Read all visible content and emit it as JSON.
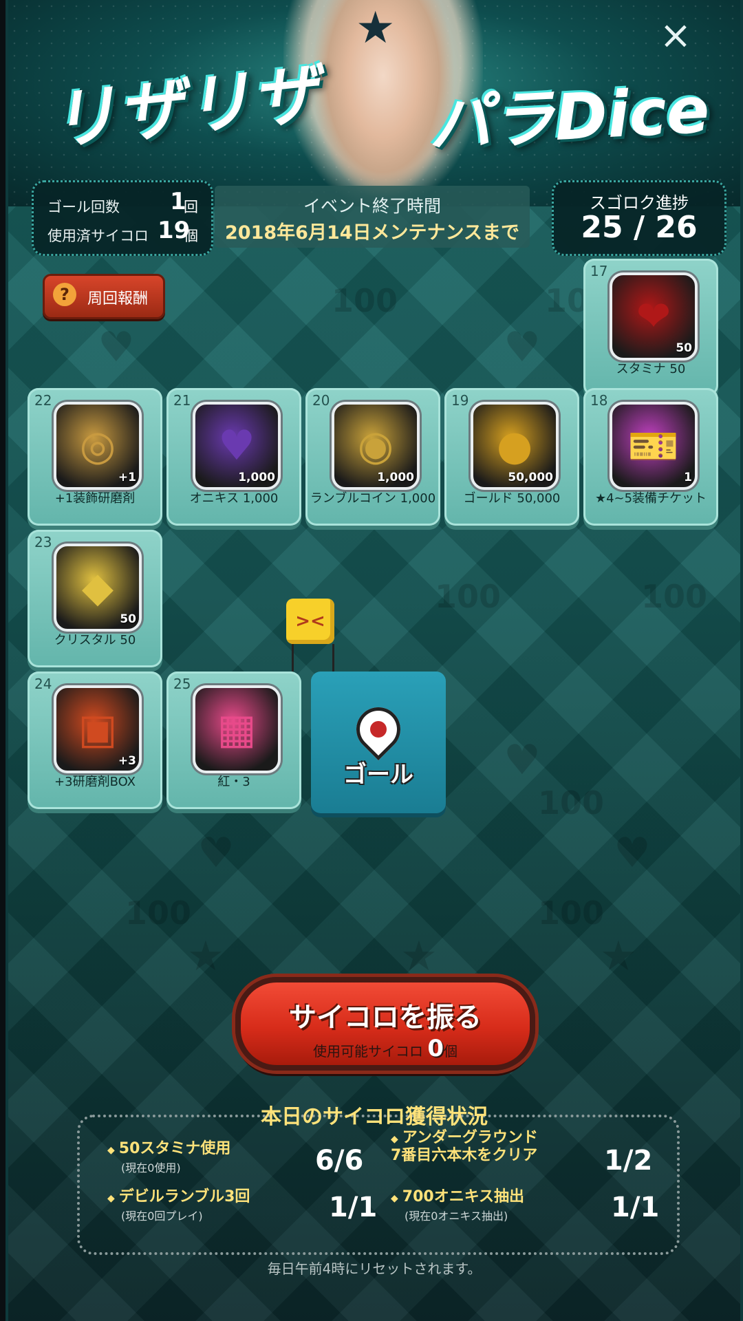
{
  "header": {
    "logo_left": "リザリザ",
    "logo_right": "パラDice",
    "close_icon": "×"
  },
  "stats": {
    "goal_count_label": "ゴール回数",
    "goal_count_value": "1",
    "goal_count_unit": "回",
    "used_dice_label": "使用済サイコロ",
    "used_dice_value": "19",
    "used_dice_unit": "個"
  },
  "event": {
    "title": "イベント終了時間",
    "date": "2018年6月14日メンテナンスまで"
  },
  "progress": {
    "label": "スゴロク進捗",
    "value": "25 / 26"
  },
  "reward_button": {
    "icon": "?",
    "label": "周回報酬"
  },
  "tiles": [
    {
      "num": "17",
      "label": "スタミナ 50",
      "badge": "50",
      "icon": "heart-icon",
      "glyph": "❤",
      "color": "#b01818"
    },
    {
      "num": "18",
      "label": "★4~5装備チケット",
      "badge": "1",
      "icon": "ticket-icon",
      "glyph": "🎫",
      "color": "#c040c0"
    },
    {
      "num": "19",
      "label": "ゴールド 50,000",
      "badge": "50,000",
      "icon": "gold-coins-icon",
      "glyph": "●",
      "color": "#d6a020"
    },
    {
      "num": "20",
      "label": "ランブルコイン 1,000",
      "badge": "1,000",
      "icon": "rumble-coin-icon",
      "glyph": "◉",
      "color": "#c9a23a"
    },
    {
      "num": "21",
      "label": "オニキス 1,000",
      "badge": "1,000",
      "icon": "onyx-icon",
      "glyph": "♥",
      "color": "#6a3ab0"
    },
    {
      "num": "22",
      "label": "+1装飾研磨剤",
      "badge": "+1",
      "icon": "polish-icon",
      "glyph": "◎",
      "color": "#c89a40"
    },
    {
      "num": "23",
      "label": "クリスタル 50",
      "badge": "50",
      "icon": "crystal-icon",
      "glyph": "◆",
      "color": "#e0c040"
    },
    {
      "num": "24",
      "label": "+3研磨剤BOX",
      "badge": "+3",
      "icon": "box-icon",
      "glyph": "▣",
      "color": "#d04a20"
    },
    {
      "num": "25",
      "label": "紅・3",
      "badge": "",
      "icon": "cube-creature-icon",
      "glyph": "▦",
      "color": "#e84a8a"
    }
  ],
  "goal": {
    "label": "ゴール"
  },
  "roll": {
    "label": "サイコロを振る",
    "available_label": "使用可能サイコロ",
    "available_value": "0",
    "available_unit": "個"
  },
  "daily": {
    "title": "本日のサイコロ獲得状況",
    "items": [
      {
        "title": "50スタミナ使用",
        "sub": "(現在0使用)",
        "value": "6/6"
      },
      {
        "title": "アンダーグラウンド\n7番目六本木をクリア",
        "sub": "",
        "value": "1/2"
      },
      {
        "title": "デビルランブル3回",
        "sub": "(現在0回プレイ)",
        "value": "1/1"
      },
      {
        "title": "700オニキス抽出",
        "sub": "(現在0オニキス抽出)",
        "value": "1/1"
      }
    ],
    "reset_note": "毎日午前4時にリセットされます。"
  }
}
